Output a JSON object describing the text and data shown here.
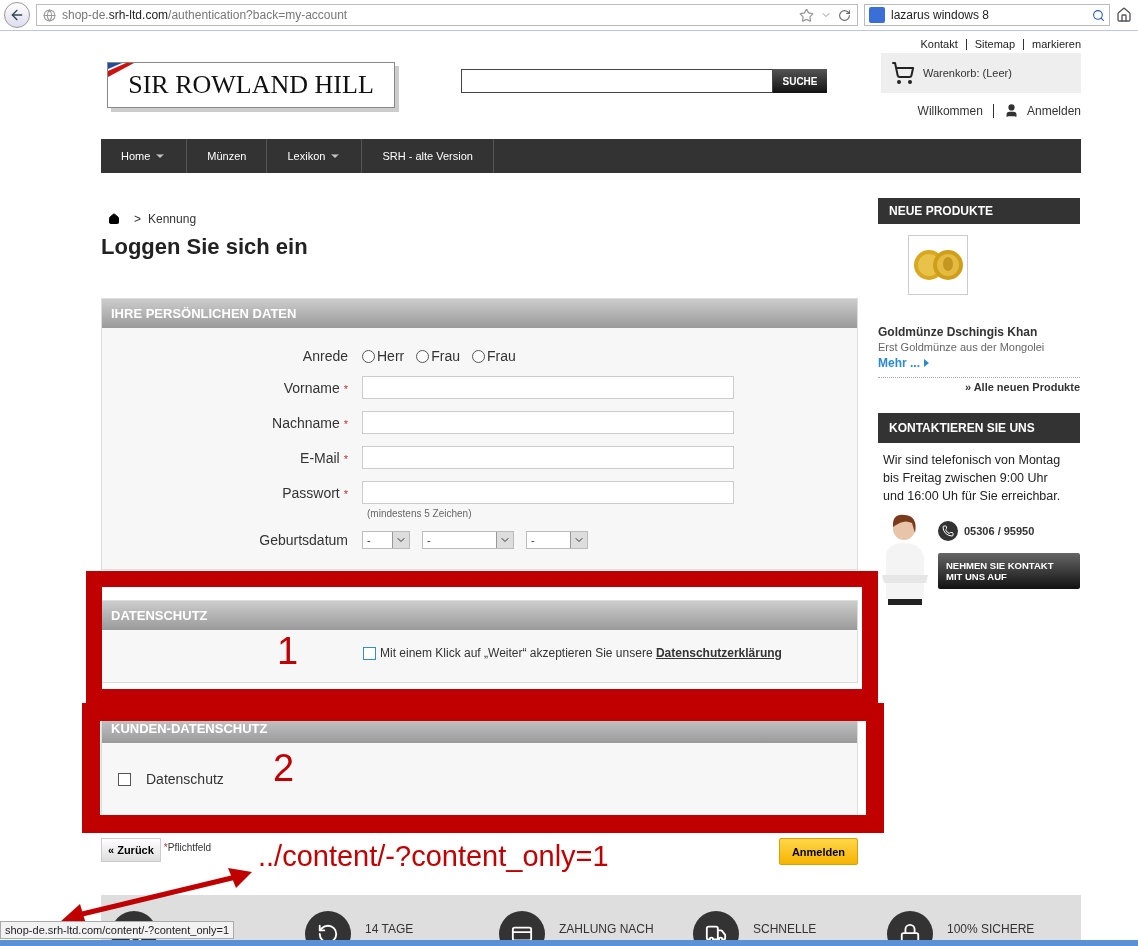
{
  "browser": {
    "url": "shop-de.**srh-ltd.com**/authentication?back=my-account",
    "search_query": "lazarus windows 8"
  },
  "header": {
    "top_links": [
      "Kontakt",
      "Sitemap",
      "markieren"
    ],
    "logo": "SIR ROWLAND HILL",
    "search_button": "SUCHE",
    "cart": "Warenkorb: (Leer)",
    "welcome": "Willkommen",
    "login": "Anmelden"
  },
  "nav": [
    {
      "label": "Home",
      "dropdown": true
    },
    {
      "label": "Münzen",
      "dropdown": false
    },
    {
      "label": "Lexikon",
      "dropdown": true
    },
    {
      "label": "SRH - alte Version",
      "dropdown": false
    }
  ],
  "breadcrumb": {
    "separator": ">",
    "label": "Kennung"
  },
  "title": "Loggen Sie sich ein",
  "personal": {
    "heading": "IHRE PERSÖNLICHEN DATEN",
    "salutation_label": "Anrede",
    "salutations": [
      {
        "label": "Herr",
        "selected": false
      },
      {
        "label": "Frau",
        "selected": false
      },
      {
        "label": "Frau",
        "selected": false
      }
    ],
    "fields": [
      {
        "label": "Vorname",
        "required": true
      },
      {
        "label": "Nachname",
        "required": true
      },
      {
        "label": "E-Mail",
        "required": true
      },
      {
        "label": "Passwort",
        "required": true
      }
    ],
    "password_hint": "(mindestens 5 Zeichen)",
    "birthdate_label": "Geburtsdatum",
    "birthdate_selects": [
      "-",
      "-",
      "-"
    ]
  },
  "privacy": {
    "heading": "DATENSCHUTZ",
    "checked": false,
    "text": "Mit einem Klick auf „Weiter“ akzeptieren Sie unsere ",
    "link": "Datenschutzerklärung"
  },
  "customer_privacy": {
    "heading": "KUNDEN-DATENSCHUTZ",
    "checked": false,
    "label": "Datenschutz"
  },
  "actions": {
    "back": "« Zurück",
    "required_mark": "*",
    "required_note": "Pflichtfeld",
    "submit": "Anmelden"
  },
  "sidebar": {
    "new_products": {
      "heading": "NEUE PRODUKTE",
      "product": "Goldmünze Dschingis Khan",
      "description": "Erst Goldmünze aus der Mongolei",
      "more": "Mehr ...",
      "all": "» Alle neuen Produkte"
    },
    "contact": {
      "heading": "KONTAKTIEREN SIE UNS",
      "text": "Wir sind telefonisch von Montag bis Freitag zwischen 9:00 Uhr und 16:00 Uh für Sie erreichbar.",
      "phone": "05306 / 95950",
      "button": "NEHMEN SIE KONTAKT MIT UNS AUF"
    }
  },
  "annotations": {
    "box_labels": [
      "1",
      "2"
    ],
    "url_note": "../content/-?content_only=1"
  },
  "features": [
    "14 TAGE",
    "ZAHLUNG NACH",
    "SCHNELLE",
    "100% SICHERE"
  ],
  "status_url": "shop-de.srh-ltd.com/content/-?content_only=1"
}
